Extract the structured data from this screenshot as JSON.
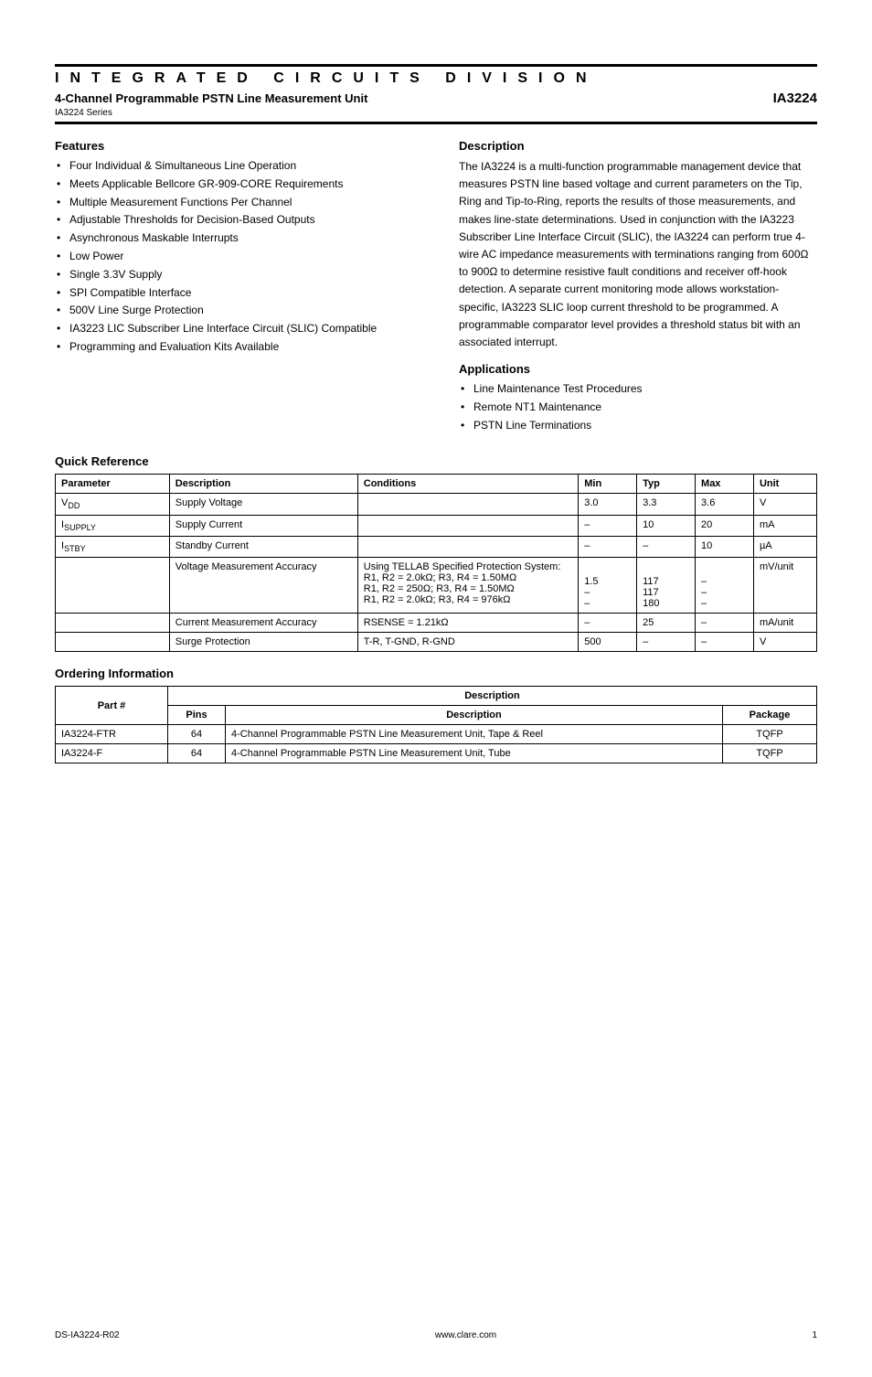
{
  "title": "INTEGRATED CIRCUITS DIVISION",
  "subtitle": "4-Channel Programmable PSTN Line Measurement Unit",
  "partno": "IA3224",
  "series": "IA3224 Series",
  "sections": {
    "features": "Features",
    "description": "Description",
    "applications": "Applications",
    "quick_ref": "Quick Reference",
    "ordering": "Ordering Information"
  },
  "features": [
    "Four Individual & Simultaneous Line Operation",
    "Meets Applicable Bellcore GR-909-CORE Requirements",
    "Multiple Measurement Functions Per Channel",
    "Adjustable Thresholds for Decision-Based Outputs",
    "Asynchronous Maskable Interrupts",
    "Low Power",
    "Single 3.3V Supply",
    "SPI Compatible Interface",
    "500V Line Surge Protection",
    "IA3223 LIC Subscriber Line Interface Circuit (SLIC) Compatible",
    "Programming and Evaluation Kits Available"
  ],
  "description": "The IA3224 is a multi-function programmable management device that measures PSTN line based voltage and current parameters on the Tip, Ring and Tip-to-Ring, reports the results of those measurements, and makes line-state determinations. Used in conjunction with the IA3223 Subscriber Line Interface Circuit (SLIC), the IA3224 can perform true 4-wire AC impedance measurements with terminations ranging from 600Ω to 900Ω to determine resistive fault conditions and receiver off-hook detection. A separate current monitoring mode allows workstation-specific, IA3223 SLIC loop current threshold to be programmed. A programmable comparator level provides a threshold status bit with an associated interrupt.",
  "applications": [
    "Line Maintenance Test Procedures",
    "Remote NT1 Maintenance",
    "PSTN Line Terminations"
  ],
  "quick_ref": {
    "headers": [
      "Parameter",
      "Description",
      "Conditions",
      "Min",
      "Typ",
      "Max",
      "Unit"
    ],
    "rows": [
      {
        "p": "V_DD",
        "d": "Supply Voltage",
        "c": "",
        "min": "3.0",
        "typ": "3.3",
        "max": "3.6",
        "u": "V"
      },
      {
        "p": "I_SUPPLY",
        "d": "Supply Current",
        "c": "",
        "min": "–",
        "typ": "10",
        "max": "20",
        "u": "mA"
      },
      {
        "p": "I_STBY",
        "d": "Standby Current",
        "c": "",
        "min": "–",
        "typ": "–",
        "max": "10",
        "u": "µA"
      },
      {
        "p": "",
        "d": "Voltage Measurement Accuracy",
        "c": "Using TELLAB Specified Protection System:\nR1, R2 = 2.0kΩ; R3, R4 = 1.50MΩ\nR1, R2 = 250Ω; R3, R4 = 1.50MΩ\nR1, R2 = 2.0kΩ; R3, R4 = 976kΩ",
        "min": "1.5\n–\n–",
        "typ": "117\n117\n180",
        "max": "–\n–\n–",
        "u": "mV/unit"
      },
      {
        "p": "",
        "d": "Current Measurement Accuracy",
        "c": "RSENSE = 1.21kΩ",
        "min": "–",
        "typ": "25",
        "max": "–",
        "u": "mA/unit"
      },
      {
        "p": "",
        "d": "Surge Protection",
        "c": "T-R, T-GND, R-GND",
        "min": "500",
        "typ": "–",
        "max": "–",
        "u": "V"
      }
    ]
  },
  "ordering": {
    "header_main": "Part #",
    "header_desc": "Description",
    "sub_pins": "Pins",
    "sub_desc": "Description",
    "sub_pack": "Package",
    "rows": [
      {
        "part": "IA3224-FTR",
        "pins": "64",
        "desc": "4-Channel Programmable PSTN Line Measurement Unit, Tape & Reel",
        "pack": "TQFP"
      },
      {
        "part": "IA3224-F",
        "pins": "64",
        "desc": "4-Channel Programmable PSTN Line Measurement Unit, Tube",
        "pack": "TQFP"
      }
    ]
  },
  "footer": {
    "code": "DS-IA3224-R02",
    "url": "www.clare.com",
    "page": "1"
  }
}
